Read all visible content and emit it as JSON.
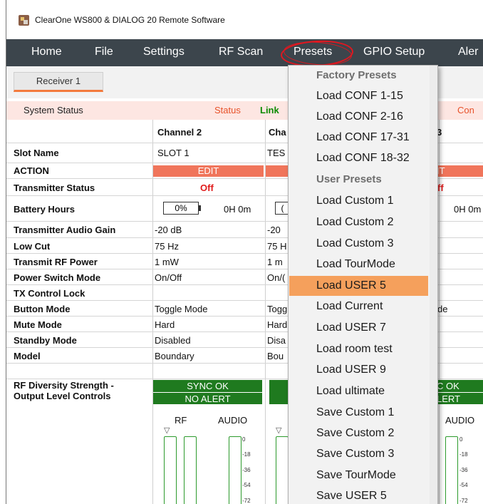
{
  "window": {
    "title": "ClearOne WS800 & DIALOG 20 Remote Software"
  },
  "menu": {
    "items": [
      "Home",
      "File",
      "Settings",
      "RF Scan",
      "Presets",
      "GPIO Setup",
      "Aler"
    ]
  },
  "tab": {
    "label": "Receiver 1"
  },
  "status": {
    "label": "System Status",
    "status": "Status",
    "link": "Link",
    "con": "Con"
  },
  "columns": {
    "ch2": "Channel 2",
    "ch3": "Cha",
    "ch4_fragment": "3"
  },
  "rows": {
    "slot_name": "Slot Name",
    "action": "ACTION",
    "tx_status": "Transmitter Status",
    "battery": "Battery Hours",
    "gain": "Transmitter Audio Gain",
    "lowcut": "Low Cut",
    "rf_power": "Transmit RF Power",
    "power_mode": "Power Switch Mode",
    "tx_lock": "TX Control Lock",
    "button_mode": "Button Mode",
    "mute_mode": "Mute Mode",
    "standby_mode": "Standby Mode",
    "model": "Model",
    "rf_div_1": "RF Diversity Strength -",
    "rf_div_2": "Output Level Controls"
  },
  "ch2": {
    "slot": "SLOT 1",
    "edit": "EDIT",
    "status": "Off",
    "battery_pct": "0%",
    "battery_hours": "0H 0m",
    "gain": "-20 dB",
    "lowcut": "75 Hz",
    "rf_power": "1 mW",
    "power_mode": "On/Off",
    "button_mode": "Toggle Mode",
    "mute_mode": "Hard",
    "standby_mode": "Disabled",
    "model": "Boundary",
    "sync": "SYNC OK",
    "alert": "NO ALERT",
    "rf": "RF",
    "audio": "AUDIO"
  },
  "ch3": {
    "slot": "TES",
    "battery_pct": "(",
    "gain": "-20",
    "lowcut": "75 H",
    "rf_power": "1 m",
    "power_mode": "On/(",
    "button_mode": "Togg",
    "mute_mode": "Hard",
    "standby_mode": "Disa",
    "model": "Bou"
  },
  "ch4": {
    "edit": "IT",
    "status": "ff",
    "battery_hours": "0H 0m",
    "button_mode": "de",
    "sync": "C OK",
    "alert": "LERT",
    "audio": "AUDIO"
  },
  "scale": [
    "0",
    "-18",
    "-36",
    "-54",
    "-72"
  ],
  "presets_menu": {
    "factory_header": "Factory Presets",
    "factory": [
      "Load CONF 1-15",
      "Load CONF 2-16",
      "Load CONF 17-31",
      "Load CONF 18-32"
    ],
    "user_header": "User Presets",
    "user": [
      "Load Custom 1",
      "Load Custom 2",
      "Load Custom 3",
      "Load TourMode",
      "Load USER 5",
      "Load Current",
      "Load USER 7",
      "Load room test",
      "Load USER 9",
      "Load ultimate",
      "Save Custom 1",
      "Save Custom 2",
      "Save Custom 3",
      "Save TourMode",
      "Save USER 5"
    ],
    "highlighted": "Load USER 5"
  },
  "colors": {
    "menubar": "#3c454c",
    "accent": "#f37a3c",
    "highlight": "#f5a05c",
    "green": "#1f7a1f",
    "red": "#e01b1b"
  }
}
